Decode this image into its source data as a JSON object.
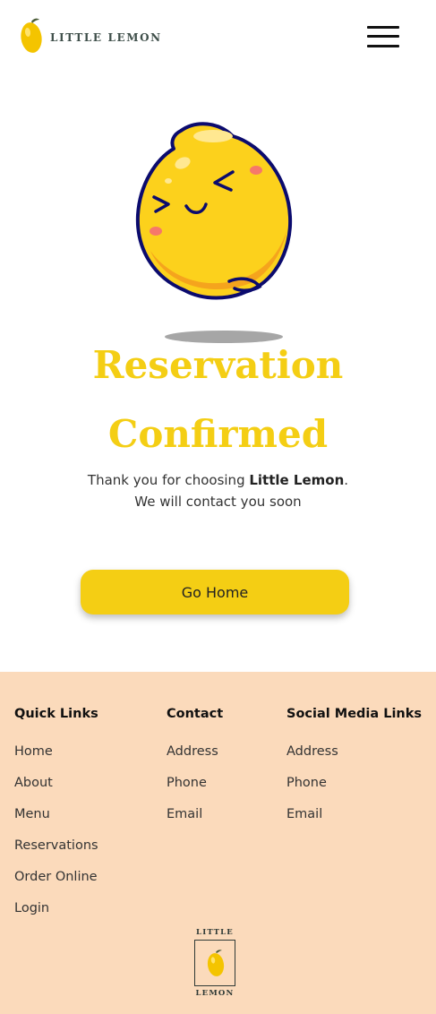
{
  "header": {
    "brand": "LITTLE LEMON",
    "logo_icon": "lemon-icon",
    "menu_icon": "hamburger-menu-icon"
  },
  "hero": {
    "illustration": "smiling-lemon-illustration",
    "title_line1": "Reservation",
    "title_line2": "Confirmed",
    "message_prefix": "Thank you for choosing ",
    "message_brand": "Little Lemon",
    "message_suffix": ".",
    "message_line2": "We will contact you soon",
    "button_label": "Go Home"
  },
  "footer": {
    "columns": [
      {
        "heading": "Quick Links",
        "links": [
          "Home",
          "About",
          "Menu",
          "Reservations",
          "Order Online",
          "Login"
        ]
      },
      {
        "heading": "Contact",
        "links": [
          "Address",
          "Phone",
          "Email"
        ]
      },
      {
        "heading": "Social Media Links",
        "links": [
          "Address",
          "Phone",
          "Email"
        ]
      }
    ],
    "logo_top": "LITTLE",
    "logo_bottom": "LEMON"
  },
  "colors": {
    "accent_yellow": "#f4ce14",
    "footer_bg": "#fbdabb",
    "lemon_body": "#fcd11c",
    "lemon_outline": "#0b0b6e"
  }
}
